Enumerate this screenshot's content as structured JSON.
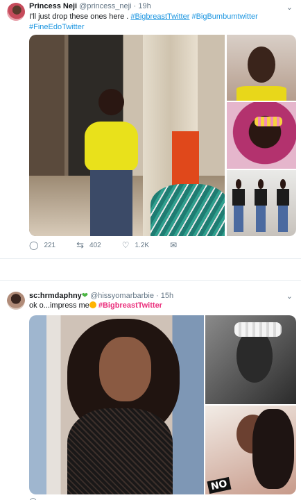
{
  "tweet1": {
    "display_name": "Princess Neji",
    "handle": "@princess_neji",
    "time": "19h",
    "text_prefix": "I'll just drop these ones here . ",
    "hashtags": [
      "#BigbreastTwitter",
      "#BigBumbumtwitter",
      "#FineEdoTwitter"
    ],
    "replies": "221",
    "retweets": "402",
    "likes": "1.2K"
  },
  "tweet2": {
    "display_name": "sc:hrmdaphny",
    "handle": "@hissyomarbarbie",
    "time": "15h",
    "text_prefix": "ok o...impress me",
    "hashtag": "#BigbreastTwitter",
    "sticker_text": "NO"
  },
  "icons": {
    "reply": "reply-icon",
    "retweet": "retweet-icon",
    "like": "heart-icon",
    "dm": "envelope-icon",
    "caret": "chevron-down-icon"
  },
  "colors": {
    "hashtag": "#1b95e0",
    "hashtag_highlight": "#ea2e7b",
    "verified_heart": "#4bb543",
    "muted": "#657786"
  }
}
